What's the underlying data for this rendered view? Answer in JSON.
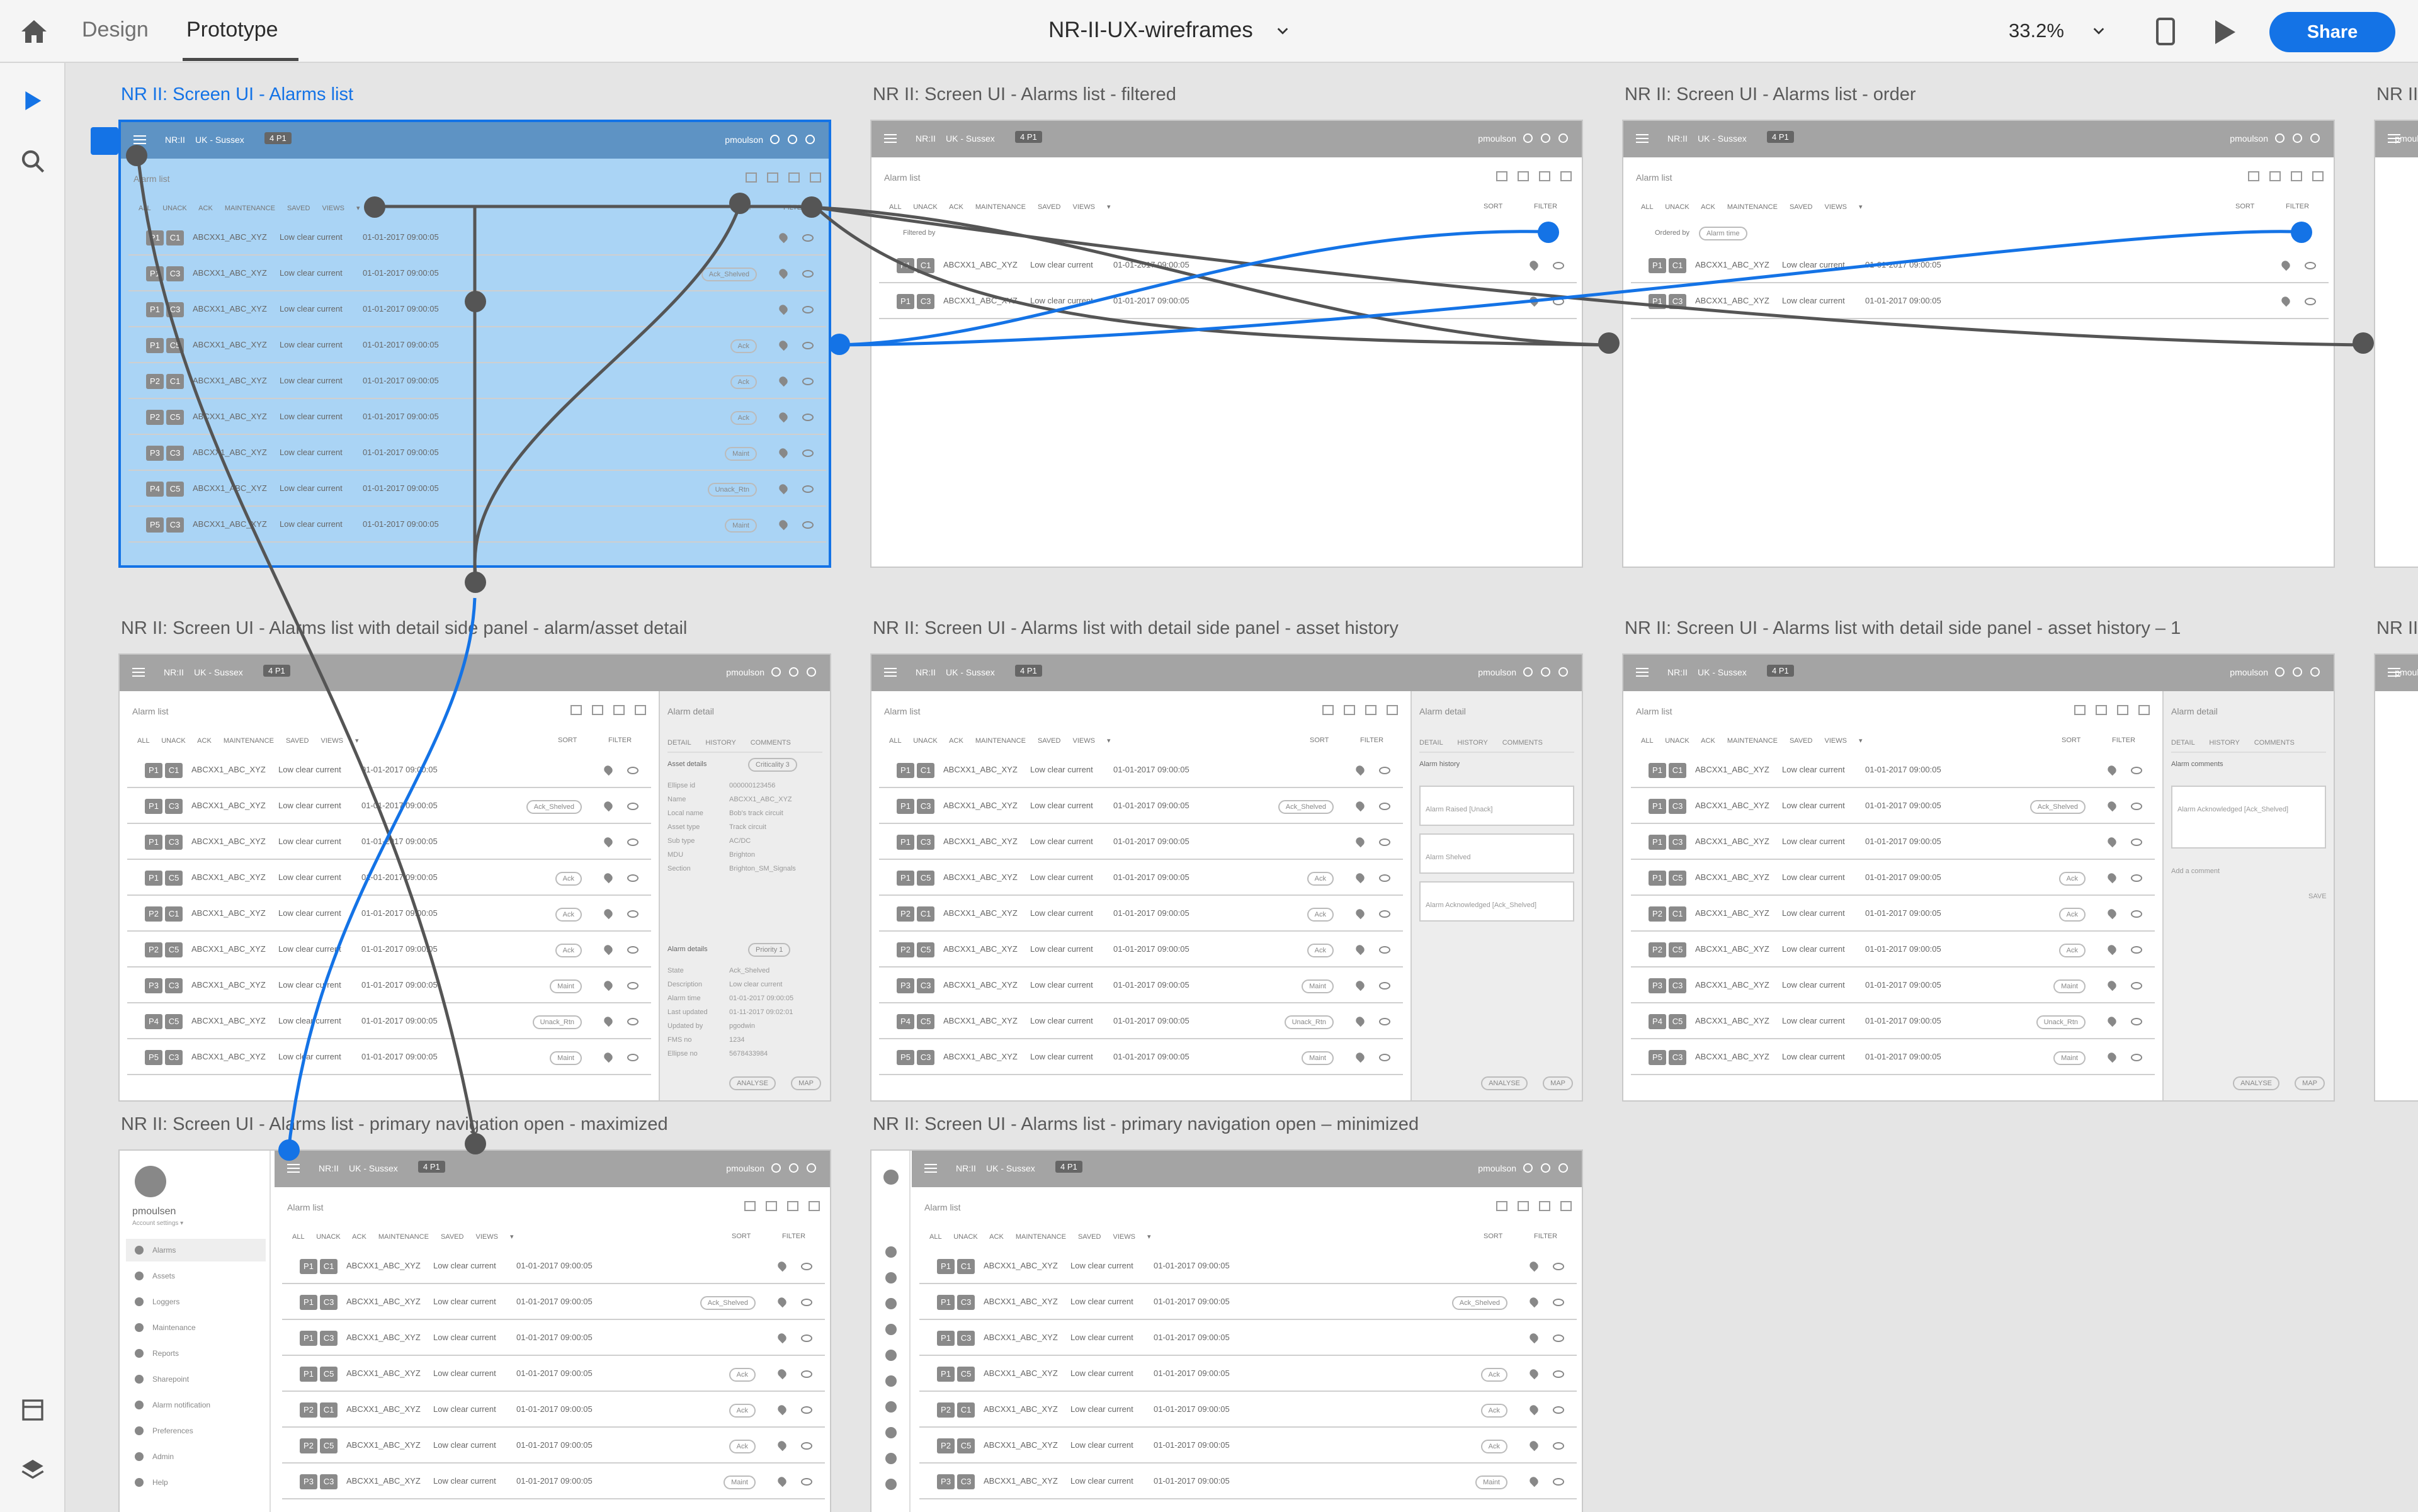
{
  "toolbar": {
    "tab_design": "Design",
    "tab_prototype": "Prototype",
    "doc_title": "NR-II-UX-wireframes",
    "zoom": "33.2%",
    "share": "Share"
  },
  "artboards": {
    "a1": "NR II: Screen UI - Alarms list",
    "a2": "NR II: Screen UI - Alarms list - filtered",
    "a3": "NR II: Screen UI - Alarms list - order",
    "a4": "NR II",
    "a5": "NR II: Screen UI - Alarms list with detail side panel - alarm/asset detail",
    "a6": "NR II: Screen UI - Alarms list with detail side panel - asset history",
    "a7": "NR II: Screen UI - Alarms list with detail side panel - asset history – 1",
    "a8": "NR II",
    "a9": "NR II: Screen UI - Alarms list - primary navigation open - maximized",
    "a10": "NR II: Screen UI - Alarms list - primary navigation open – minimized"
  },
  "screen": {
    "brand": "NR:II",
    "location": "UK - Sussex",
    "pill": "4 P1",
    "user": "pmoulson",
    "list_title": "Alarm list",
    "tabs": "ALL UNACK ACK MAINTENANCE SAVED VIEWS ▾",
    "sort": "SORT",
    "filter": "FILTER",
    "asset": "ABCXX1_ABC_XYZ",
    "desc": "Low clear current",
    "date": "01-01-2017 09:00:05"
  },
  "rows": [
    {
      "p": "P1",
      "c": "C1",
      "tag": ""
    },
    {
      "p": "P1",
      "c": "C3",
      "tag": "Ack_Shelved"
    },
    {
      "p": "P1",
      "c": "C3",
      "tag": ""
    },
    {
      "p": "P1",
      "c": "C5",
      "tag": "Ack"
    },
    {
      "p": "P2",
      "c": "C1",
      "tag": "Ack"
    },
    {
      "p": "P2",
      "c": "C5",
      "tag": "Ack"
    },
    {
      "p": "P3",
      "c": "C3",
      "tag": "Maint"
    },
    {
      "p": "P4",
      "c": "C5",
      "tag": "Unack_Rtn"
    },
    {
      "p": "P5",
      "c": "C3",
      "tag": "Maint"
    }
  ],
  "filtered_rows": [
    {
      "p": "P1",
      "c": "C1"
    },
    {
      "p": "P1",
      "c": "C3"
    }
  ],
  "filters": {
    "filtered_by": "Filtered by",
    "ordered_by": "Ordered by",
    "order_chip": "Alarm time"
  },
  "panel": {
    "title": "Alarm detail",
    "tabs": "DETAIL HISTORY COMMENTS",
    "asset_details": "Asset details",
    "criticality": "Criticality 3",
    "alarm_details": "Alarm details",
    "priority": "Priority 1",
    "history_title": "Alarm history",
    "comments_title": "Alarm comments",
    "add_comment": "Add a comment",
    "save": "SAVE",
    "analyse": "ANALYSE",
    "map": "MAP",
    "history_1": "Alarm Raised [Unack]",
    "history_2": "Alarm Shelved",
    "history_3": "Alarm Acknowledged [Ack_Shelved]",
    "fields": [
      [
        "Ellipse id",
        "000000123456"
      ],
      [
        "Name",
        "ABCXX1_ABC_XYZ"
      ],
      [
        "Local name",
        "Bob's track circuit"
      ],
      [
        "Asset type",
        "Track circuit"
      ],
      [
        "Sub type",
        "AC/DC"
      ],
      [
        "MDU",
        "Brighton"
      ],
      [
        "Section",
        "Brighton_SM_Signals"
      ]
    ],
    "alarm_fields": [
      [
        "State",
        "Ack_Shelved"
      ],
      [
        "Description",
        "Low clear current"
      ],
      [
        "Alarm time",
        "01-01-2017 09:00:05"
      ],
      [
        "Last updated",
        "01-11-2017 09:02:01"
      ],
      [
        "Updated by",
        "pgodwin"
      ],
      [
        "FMS no",
        "1234"
      ],
      [
        "Ellipse no",
        "5678433984"
      ]
    ]
  },
  "nav": {
    "user": "pmoulsen",
    "account": "Account settings ▾",
    "items": [
      "Alarms",
      "Assets",
      "Loggers",
      "Maintenance",
      "Reports",
      "Sharepoint",
      "Alarm notification",
      "Preferences",
      "Admin",
      "Help"
    ]
  }
}
